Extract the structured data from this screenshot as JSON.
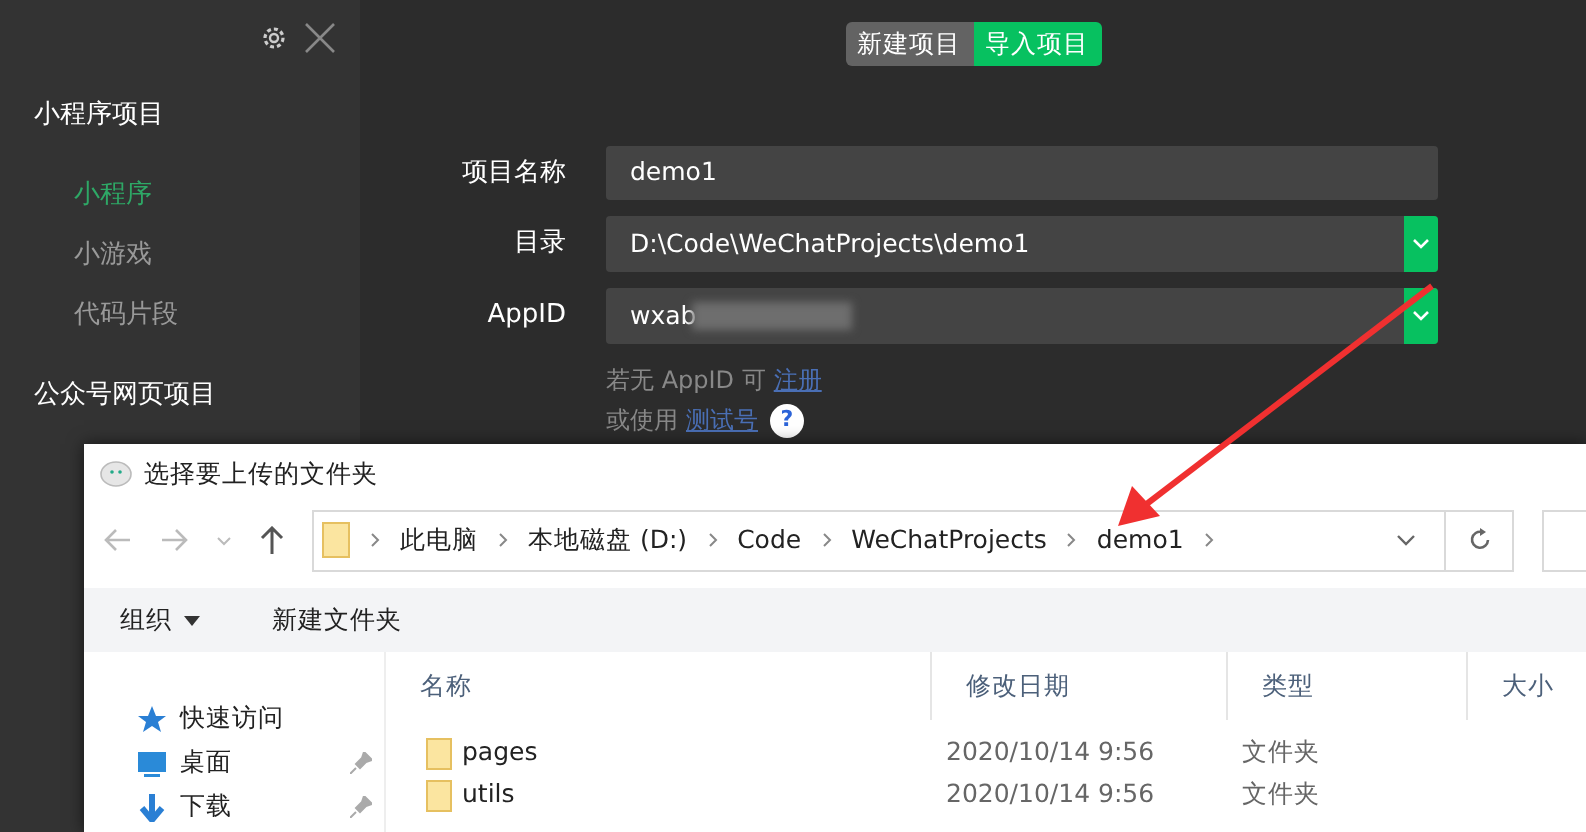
{
  "sidebar": {
    "sections": [
      {
        "title": "小程序项目",
        "items": [
          {
            "label": "小程序",
            "selected": true
          },
          {
            "label": "小游戏",
            "selected": false
          },
          {
            "label": "代码片段",
            "selected": false
          }
        ]
      },
      {
        "title": "公众号网页项目"
      }
    ]
  },
  "tabs": [
    {
      "label": "新建项目",
      "selected": false
    },
    {
      "label": "导入项目",
      "selected": true
    }
  ],
  "form": {
    "fields": [
      {
        "label": "项目名称",
        "value": "demo1",
        "kind": "text"
      },
      {
        "label": "目录",
        "value": "D:\\Code\\WeChatProjects\\demo1",
        "kind": "select"
      },
      {
        "label": "AppID",
        "value": "wxab",
        "kind": "select",
        "redacted": true
      }
    ],
    "hints": [
      {
        "text": "若无 AppID 可",
        "link": "注册"
      },
      {
        "text": "或使用",
        "link": "测试号",
        "help": "?"
      }
    ]
  },
  "dialog": {
    "title": "选择要上传的文件夹",
    "breadcrumb": [
      "此电脑",
      "本地磁盘 (D:)",
      "Code",
      "WeChatProjects",
      "demo1"
    ],
    "toolbar": [
      {
        "label": "组织",
        "kind": "menu"
      },
      {
        "label": "新建文件夹",
        "kind": "button"
      }
    ],
    "nav": [
      {
        "label": "快速访问",
        "kind": "quick",
        "pinned": false
      },
      {
        "label": "桌面",
        "kind": "desktop",
        "pinned": true
      },
      {
        "label": "下载",
        "kind": "download",
        "pinned": true
      }
    ],
    "columns": [
      "名称",
      "修改日期",
      "类型",
      "大小"
    ],
    "rows": [
      {
        "name": "pages",
        "date": "2020/10/14 9:56",
        "type": "文件夹"
      },
      {
        "name": "utils",
        "date": "2020/10/14 9:56",
        "type": "文件夹"
      }
    ]
  }
}
